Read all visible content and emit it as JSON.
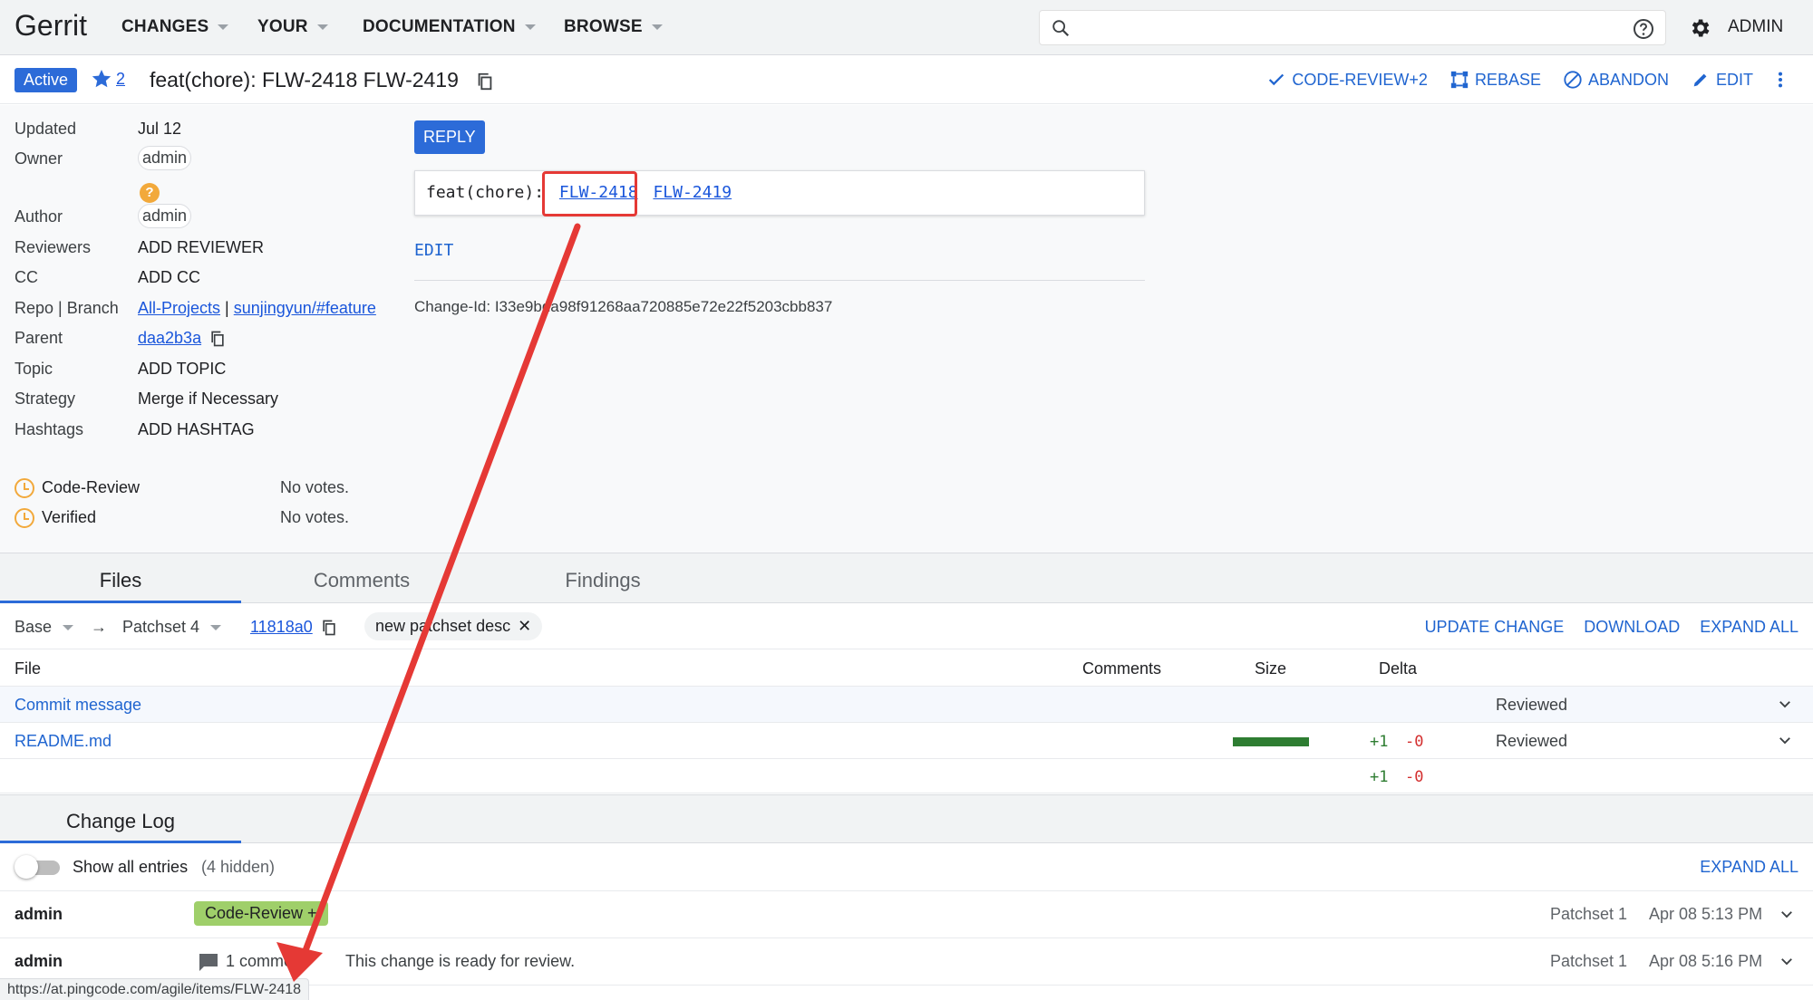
{
  "header": {
    "logo": "Gerrit",
    "nav": [
      "CHANGES",
      "YOUR",
      "DOCUMENTATION",
      "BROWSE"
    ],
    "user": "ADMIN"
  },
  "change": {
    "status": "Active",
    "star_count": "2",
    "subject": "feat(chore): FLW-2418 FLW-2419",
    "actions": [
      "CODE-REVIEW+2",
      "REBASE",
      "ABANDON",
      "EDIT"
    ]
  },
  "metadata": {
    "updated_label": "Updated",
    "updated_value": "Jul 12",
    "owner_label": "Owner",
    "owner_value": "admin",
    "owner_warning": "?",
    "author_label": "Author",
    "author_value": "admin",
    "reviewers_label": "Reviewers",
    "reviewers_value": "ADD REVIEWER",
    "cc_label": "CC",
    "cc_value": "ADD CC",
    "repo_label": "Repo | Branch",
    "repo_value": "All-Projects",
    "repo_sep": "|",
    "branch_value": "sunjingyun/#feature",
    "parent_label": "Parent",
    "parent_value": "daa2b3a",
    "topic_label": "Topic",
    "topic_value": "ADD TOPIC",
    "strategy_label": "Strategy",
    "strategy_value": "Merge if Necessary",
    "hashtags_label": "Hashtags",
    "hashtags_value": "ADD HASHTAG"
  },
  "commit": {
    "reply_label": "REPLY",
    "message_prefix": "feat(chore):",
    "link1": "FLW-2418",
    "link2": "FLW-2419",
    "edit_label": "EDIT",
    "change_id": "Change-Id: I33e9bda98f91268aa720885e72e22f5203cbb837"
  },
  "labels": [
    {
      "name": "Code-Review",
      "votes": "No votes."
    },
    {
      "name": "Verified",
      "votes": "No votes."
    }
  ],
  "tabs": [
    "Files",
    "Comments",
    "Findings"
  ],
  "files_ctrl": {
    "base": "Base",
    "arrow": "→",
    "patchset": "Patchset 4",
    "commit": "11818a0",
    "desc": "new patchset desc",
    "actions": [
      "UPDATE CHANGE",
      "DOWNLOAD",
      "EXPAND ALL"
    ]
  },
  "file_table": {
    "headers": {
      "file": "File",
      "comments": "Comments",
      "size": "Size",
      "delta": "Delta"
    },
    "rows": [
      {
        "name": "Commit message",
        "status": "Reviewed"
      },
      {
        "name": "README.md",
        "plus": "+1",
        "minus": "-0",
        "status": "Reviewed"
      }
    ],
    "total_plus": "+1",
    "total_minus": "-0"
  },
  "change_log": {
    "title": "Change Log",
    "toggle_label": "Show all entries",
    "hidden": "(4 hidden)",
    "expand_all": "EXPAND ALL",
    "entries": [
      {
        "who": "admin",
        "badge": "Code-Review +",
        "patchset": "Patchset 1",
        "date": "Apr 08 5:13 PM"
      },
      {
        "who": "admin",
        "comment_count": "1 comme",
        "message": "This change is ready for review.",
        "patchset": "Patchset 1",
        "date": "Apr 08 5:16 PM"
      }
    ]
  },
  "status_url": "https://at.pingcode.com/agile/items/FLW-2418",
  "colors": {
    "accent": "#2c6bd8",
    "link": "#1a56db",
    "annotation": "#e53935",
    "warning": "#f2a93b",
    "positive": "#2e7d32",
    "negative": "#d32f2f"
  }
}
